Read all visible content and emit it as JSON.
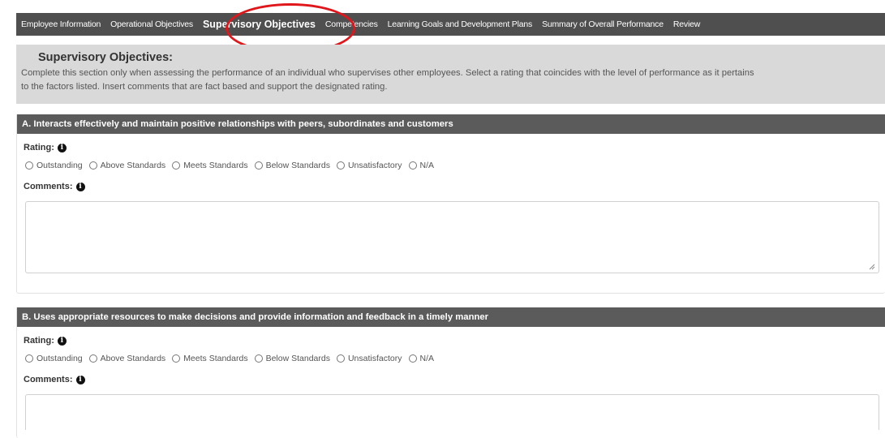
{
  "tabs": [
    {
      "label": "Employee Information",
      "active": false
    },
    {
      "label": "Operational Objectives",
      "active": false
    },
    {
      "label": "Supervisory Objectives",
      "active": true
    },
    {
      "label": "Competencies",
      "active": false
    },
    {
      "label": "Learning Goals and Development Plans",
      "active": false
    },
    {
      "label": "Summary of Overall Performance",
      "active": false
    },
    {
      "label": "Review",
      "active": false
    }
  ],
  "intro": {
    "title": "Supervisory Objectives:",
    "line1": "Complete this section only when assessing the performance of an individual who supervises other employees. Select a rating that coincides with the level of performance as it pertains",
    "line2": "to the factors listed. Insert comments that are fact based and support the designated rating."
  },
  "sections": [
    {
      "heading": "A. Interacts effectively and maintain positive relationships with peers, subordinates and customers",
      "rating_label": "Rating:",
      "comments_label": "Comments:",
      "comments_value": ""
    },
    {
      "heading": "B. Uses appropriate resources to make decisions and provide information and feedback in a timely manner",
      "rating_label": "Rating:",
      "comments_label": "Comments:",
      "comments_value": ""
    }
  ],
  "rating_options": [
    "Outstanding",
    "Above Standards",
    "Meets Standards",
    "Below Standards",
    "Unsatisfactory",
    "N/A"
  ],
  "info_icon_glyph": "i",
  "colors": {
    "tab_bar": "#4f4f4f",
    "section_header": "#5b5b5b",
    "intro_background": "#d9d9d9",
    "highlight_ring": "#e0161b"
  }
}
